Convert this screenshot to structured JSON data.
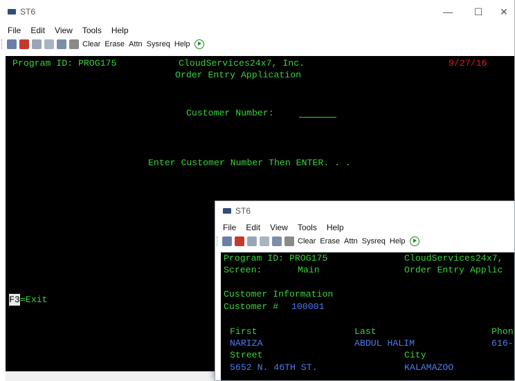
{
  "main_window": {
    "title": "ST6",
    "window_controls": {
      "minimize": "—",
      "maximize": "☐",
      "close": "✕"
    },
    "menu": [
      "File",
      "Edit",
      "View",
      "Tools",
      "Help"
    ],
    "toolbar": {
      "buttons": [
        "Clear",
        "Erase",
        "Attn",
        "Sysreq",
        "Help"
      ]
    },
    "screen": {
      "program_id": "Program ID: PROG175",
      "company": "CloudServices24x7, Inc.",
      "date": "9/27/16",
      "app_name": "Order Entry Application",
      "customer_number_label": "Customer Number:",
      "prompt": "Enter Customer Number Then ENTER. . .",
      "f3_key": "F3",
      "f3_action": "=Exit"
    }
  },
  "sub_window": {
    "title": "ST6",
    "menu": [
      "File",
      "Edit",
      "View",
      "Tools",
      "Help"
    ],
    "toolbar": {
      "buttons": [
        "Clear",
        "Erase",
        "Attn",
        "Sysreq",
        "Help"
      ]
    },
    "screen": {
      "program_id": "Program ID: PROG175",
      "company": "CloudServices24x7,",
      "screen_label": "Screen:",
      "screen_value": "Main",
      "app_name": "Order Entry Applic",
      "section_title": "Customer Information",
      "customer_label": "Customer #",
      "customer_number": "100001",
      "col_first": "First",
      "col_last": "Last",
      "col_phone": "Phon",
      "first_name": "NARIZA",
      "last_name": "ABDUL HALIM",
      "phone": "616-",
      "col_street": "Street",
      "col_city": "City",
      "street": "5652 N. 46TH ST.",
      "city": "KALAMAZOO"
    }
  }
}
